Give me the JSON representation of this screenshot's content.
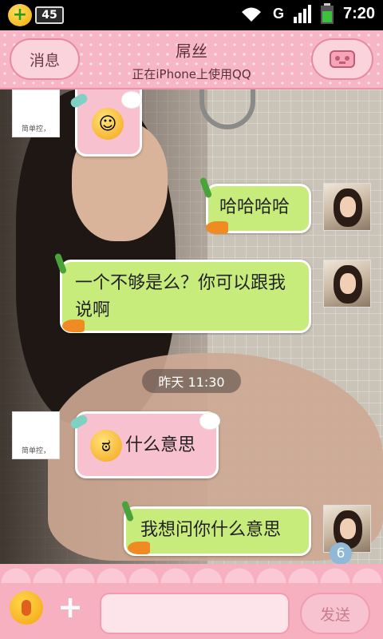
{
  "status_bar": {
    "app_badge": "45",
    "network": "G",
    "time": "7:20"
  },
  "header": {
    "back_label": "消息",
    "title": "屌丝",
    "subtitle": "正在iPhone上使用QQ"
  },
  "messages": [
    {
      "side": "left",
      "avatar_caption": "简单控，",
      "text": "",
      "emoji": "blush-emoji"
    },
    {
      "side": "right",
      "text": "哈哈哈哈"
    },
    {
      "side": "right",
      "text": "一个不够是么？你可以跟我说啊"
    },
    {
      "side": "left",
      "avatar_caption": "简单控，",
      "text": "什么意思",
      "emoji": "angry-emoji"
    },
    {
      "side": "right",
      "text": "我想问你什么意思"
    }
  ],
  "timestamp": "昨天 11:30",
  "unread_badge": "6",
  "input": {
    "placeholder": "",
    "send_label": "发送"
  },
  "colors": {
    "header_bg": "#f7b6c6",
    "pink_bubble": "#f8c1d0",
    "green_bubble": "#c8ec7c"
  }
}
